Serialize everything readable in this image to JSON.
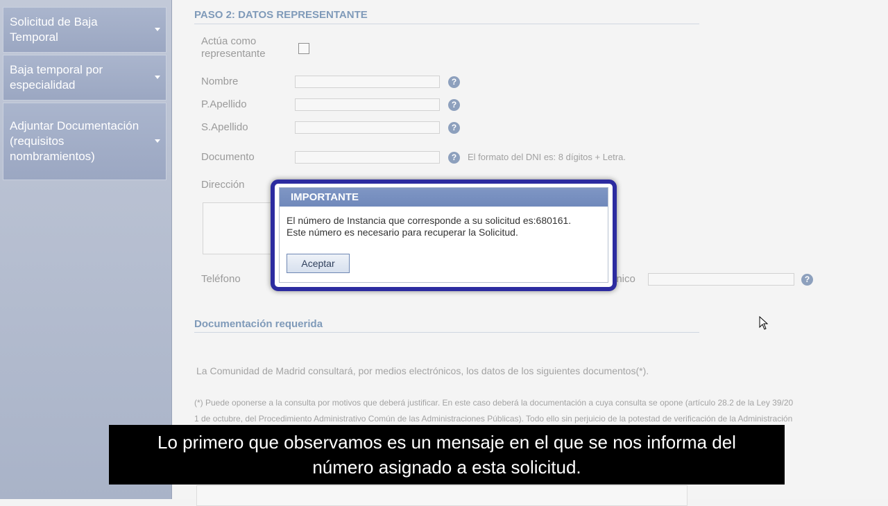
{
  "sidebar": {
    "items": [
      {
        "label": "Solicitud de Baja Temporal"
      },
      {
        "label": "Baja temporal por especialidad"
      },
      {
        "label": "Adjuntar Documentación (requisitos nombramientos)"
      }
    ]
  },
  "form": {
    "step_title": "PASO 2: DATOS REPRESENTANTE",
    "acts_as_rep_label": "Actúa como representante",
    "acts_as_rep_checked": false,
    "fields": {
      "nombre": {
        "label": "Nombre",
        "value": ""
      },
      "p_apellido": {
        "label": "P.Apellido",
        "value": ""
      },
      "s_apellido": {
        "label": "S.Apellido",
        "value": ""
      },
      "documento": {
        "label": "Documento",
        "value": "",
        "hint": "El formato del DNI es: 8 dígitos + Letra."
      },
      "direccion": {
        "label": "Dirección"
      },
      "telefono": {
        "label": "Teléfono"
      },
      "email": {
        "label_fragment": "ónico"
      }
    },
    "help_glyph": "?"
  },
  "documentation": {
    "title": "Documentación requerida",
    "intro": "La Comunidad de Madrid consultará, por medios electrónicos, los datos de los siguientes documentos(*).",
    "note_line1": "(*) Puede oponerse a la consulta por motivos que deberá justificar. En este caso deberá la documentación a cuya consulta se opone (artículo 28.2 de la Ley 39/20",
    "note_line2": "1 de octubre, del Procedimiento Administrativo Común de las Administraciones Públicas). Todo ello sin perjuicio de la potestad de verificación de la Administración"
  },
  "modal": {
    "title": "IMPORTANTE",
    "message_line1": "El número de Instancia que corresponde a su solicitud es:680161.",
    "message_line2": "Este número es necesario para recuperar la Solicitud.",
    "accept_label": "Aceptar"
  },
  "subtitle": {
    "line1": "Lo primero que observamos es un mensaje en el que se nos informa del",
    "line2": "número asignado a esta solicitud."
  },
  "colors": {
    "accent": "#7f96c4",
    "modal_border": "#2c2ba0",
    "section_title": "#7f9ab9"
  }
}
